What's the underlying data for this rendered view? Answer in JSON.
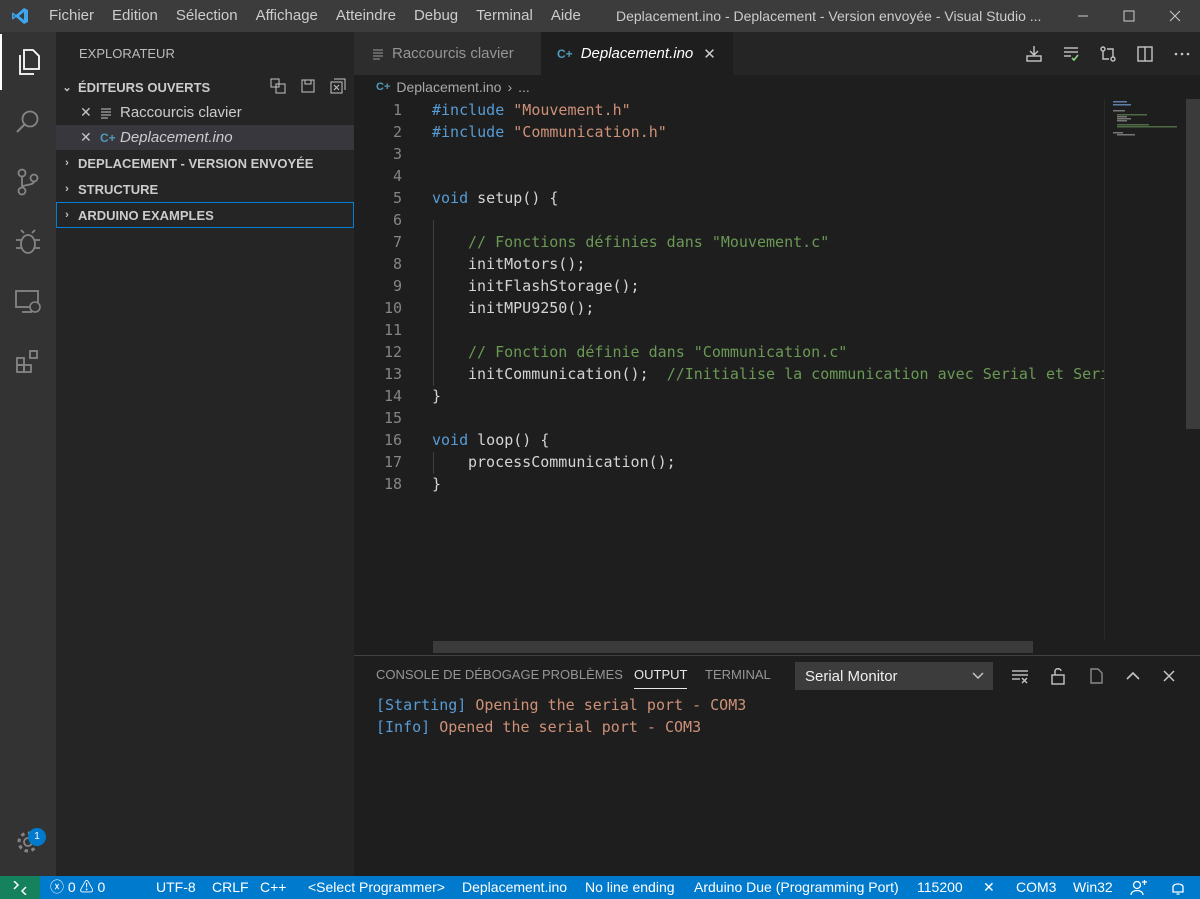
{
  "titlebar": {
    "menu": [
      "Fichier",
      "Edition",
      "Sélection",
      "Affichage",
      "Atteindre",
      "Debug",
      "Terminal",
      "Aide"
    ],
    "window_title": "Deplacement.ino - Deplacement - Version envoyée - Visual Studio ..."
  },
  "activitybar": {
    "items": [
      "explorer-icon",
      "search-icon",
      "source-control-icon",
      "debug-icon",
      "remote-explorer-icon",
      "extensions-icon"
    ],
    "settings_badge": "1"
  },
  "sidebar": {
    "title": "EXPLORATEUR",
    "open_editors": {
      "label": "ÉDITEURS OUVERTS",
      "files": [
        {
          "name": "Raccourcis clavier",
          "italic": false
        },
        {
          "name": "Deplacement.ino",
          "italic": true
        }
      ]
    },
    "sections": [
      "DEPLACEMENT - VERSION ENVOYÉE",
      "STRUCTURE",
      "ARDUINO EXAMPLES"
    ]
  },
  "tabs": [
    {
      "label": "Raccourcis clavier",
      "active": false
    },
    {
      "label": "Deplacement.ino",
      "active": true
    }
  ],
  "breadcrumb": {
    "file": "Deplacement.ino",
    "more": "..."
  },
  "code": {
    "line_numbers": [
      "1",
      "2",
      "3",
      "4",
      "5",
      "6",
      "7",
      "8",
      "9",
      "10",
      "11",
      "12",
      "13",
      "14",
      "15",
      "16",
      "17",
      "18"
    ],
    "l1": {
      "kw": "#include",
      "str": "\"Mouvement.h\""
    },
    "l2": {
      "kw": "#include",
      "str": "\"Communication.h\""
    },
    "l5": {
      "kw": "void",
      "rest": " setup() {"
    },
    "l7": "// Fonctions définies dans \"Mouvement.c\"",
    "l8": "initMotors();",
    "l9": "initFlashStorage();",
    "l10": "initMPU9250();",
    "l12": "// Fonction définie dans \"Communication.c\"",
    "l13": {
      "code": "initCommunication();",
      "cmt": "//Initialise la communication avec Serial et Seri"
    },
    "l14": "}",
    "l16": {
      "kw": "void",
      "rest": " loop() {"
    },
    "l17": "processCommunication();",
    "l18": "}"
  },
  "panel": {
    "tabs": [
      "CONSOLE DE DÉBOGAGE",
      "PROBLÈMES",
      "OUTPUT",
      "TERMINAL"
    ],
    "active_tab": "OUTPUT",
    "channel": "Serial Monitor",
    "output": [
      {
        "tag": "[Starting]",
        "msg": " Opening the serial port - COM3"
      },
      {
        "tag": "[Info]",
        "msg": " Opened the serial port - COM3"
      }
    ]
  },
  "statusbar": {
    "errors": "0",
    "warnings": "0",
    "encoding": "UTF-8",
    "eol": "CRLF",
    "language": "C++",
    "programmer": "<Select Programmer>",
    "sketch": "Deplacement.ino",
    "line_ending": "No line ending",
    "board": "Arduino Due (Programming Port)",
    "baud": "115200",
    "close_monitor": "✕",
    "port": "COM3",
    "platform": "Win32"
  },
  "colors": {
    "accent": "#007acc",
    "remote": "#16825d",
    "keyword": "#569cd6",
    "string": "#ce9178",
    "comment": "#6a9955"
  }
}
